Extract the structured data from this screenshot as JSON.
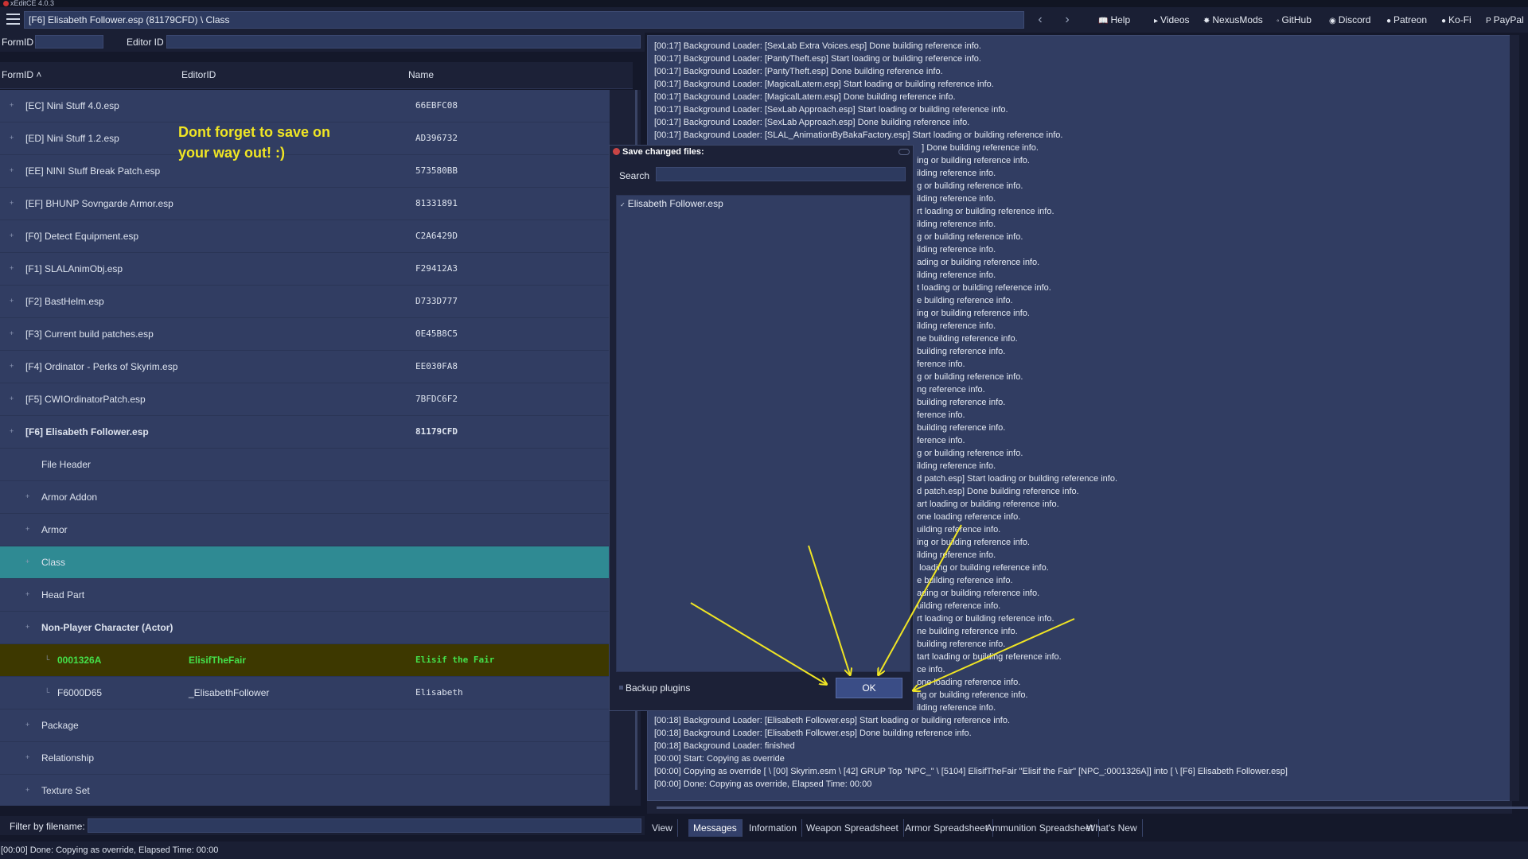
{
  "app": {
    "title": "xEditCE 4.0.3"
  },
  "header": {
    "path": "[F6] Elisabeth Follower.esp (81179CFD) \\ Class",
    "links": [
      {
        "label": "Help",
        "icon": "book-icon"
      },
      {
        "label": "Videos",
        "icon": "video-icon"
      },
      {
        "label": "NexusMods",
        "icon": "nexus-icon"
      },
      {
        "label": "GitHub",
        "icon": "github-icon"
      },
      {
        "label": "Discord",
        "icon": "discord-icon"
      },
      {
        "label": "Patreon",
        "icon": "patreon-icon"
      },
      {
        "label": "Ko-Fi",
        "icon": "kofi-icon"
      },
      {
        "label": "PayPal",
        "icon": "paypal-icon"
      }
    ]
  },
  "fields": {
    "formid_label": "FormID",
    "editorid_label": "Editor ID"
  },
  "columns": {
    "formid": "FormID",
    "editorid": "EditorID",
    "name": "Name"
  },
  "tree": [
    {
      "c1": "[EC] Nini Stuff 4.0.esp",
      "c2": "",
      "c3": "66EBFC08",
      "indent": 0
    },
    {
      "c1": "[ED] Nini Stuff 1.2.esp",
      "c2": "",
      "c3": "AD396732",
      "indent": 0
    },
    {
      "c1": "[EE] NINI Stuff Break Patch.esp",
      "c2": "",
      "c3": "573580BB",
      "indent": 0
    },
    {
      "c1": "[EF] BHUNP Sovngarde Armor.esp",
      "c2": "",
      "c3": "81331891",
      "indent": 0
    },
    {
      "c1": "[F0] Detect Equipment.esp",
      "c2": "",
      "c3": "C2A6429D",
      "indent": 0
    },
    {
      "c1": "[F1] SLALAnimObj.esp",
      "c2": "",
      "c3": "F29412A3",
      "indent": 0
    },
    {
      "c1": "[F2] BastHelm.esp",
      "c2": "",
      "c3": "D733D777",
      "indent": 0
    },
    {
      "c1": "[F3] Current build patches.esp",
      "c2": "",
      "c3": "0E45B8C5",
      "indent": 0
    },
    {
      "c1": "[F4] Ordinator - Perks of Skyrim.esp",
      "c2": "",
      "c3": "EE030FA8",
      "indent": 0
    },
    {
      "c1": "[F5] CWIOrdinatorPatch.esp",
      "c2": "",
      "c3": "7BFDC6F2",
      "indent": 0
    },
    {
      "c1": "[F6] Elisabeth Follower.esp",
      "c2": "",
      "c3": "81179CFD",
      "indent": 0,
      "bold": true
    },
    {
      "c1": "File Header",
      "c2": "",
      "c3": "",
      "indent": 1,
      "noexp": true
    },
    {
      "c1": "Armor Addon",
      "c2": "",
      "c3": "",
      "indent": 1
    },
    {
      "c1": "Armor",
      "c2": "",
      "c3": "",
      "indent": 1
    },
    {
      "c1": "Class",
      "c2": "",
      "c3": "",
      "indent": 1,
      "selected": true
    },
    {
      "c1": "Head Part",
      "c2": "",
      "c3": "",
      "indent": 1
    },
    {
      "c1": "Non-Player Character (Actor)",
      "c2": "",
      "c3": "",
      "indent": 1,
      "bold": true
    },
    {
      "c1": "0001326A",
      "c2": "ElisifTheFair",
      "c3": "Elisif the Fair",
      "indent": 2,
      "highlight": true,
      "noexp": true
    },
    {
      "c1": "F6000D65",
      "c2": "_ElisabethFollower",
      "c3": "Elisabeth",
      "indent": 2,
      "noexp": true
    },
    {
      "c1": "Package",
      "c2": "",
      "c3": "",
      "indent": 1
    },
    {
      "c1": "Relationship",
      "c2": "",
      "c3": "",
      "indent": 1
    },
    {
      "c1": "Texture Set",
      "c2": "",
      "c3": "",
      "indent": 1
    }
  ],
  "annotation": "Dont forget to save on\nyour way out! :)",
  "filter": {
    "label": "Filter by filename:"
  },
  "status": {
    "text": "[00:00] Done: Copying as override, Elapsed Time: 00:00"
  },
  "messages": [
    "[00:17] Background Loader: [SexLab Extra Voices.esp] Done building reference info.",
    "[00:17] Background Loader: [PantyTheft.esp] Start loading or building reference info.",
    "[00:17] Background Loader: [PantyTheft.esp] Done building reference info.",
    "[00:17] Background Loader: [MagicalLatern.esp] Start loading or building reference info.",
    "[00:17] Background Loader: [MagicalLatern.esp] Done building reference info.",
    "[00:17] Background Loader: [SexLab Approach.esp] Start loading or building reference info.",
    "[00:17] Background Loader: [SexLab Approach.esp] Done building reference info.",
    "[00:17] Background Loader: [SLAL_AnimationByBakaFactory.esp] Start loading or building reference info.",
    "                                                                                                              ] Done building reference info.",
    "                                                                                                            ing or building reference info.",
    "                                                                                                            ilding reference info.",
    "                                                                                                            g or building reference info.",
    "                                                                                                            ilding reference info.",
    "                                                                                                            rt loading or building reference info.",
    "                                                                                                            ilding reference info.",
    "                                                                                                            g or building reference info.",
    "                                                                                                            ilding reference info.",
    "                                                                                                            ading or building reference info.",
    "                                                                                                            ilding reference info.",
    "                                                                                                            t loading or building reference info.",
    "                                                                                                            e building reference info.",
    "                                                                                                            ing or building reference info.",
    "                                                                                                            ilding reference info.",
    "                                                                                                            ne building reference info.",
    "                                                                                                            building reference info.",
    "                                                                                                            ference info.",
    "                                                                                                            g or building reference info.",
    "                                                                                                            ng reference info.",
    "                                                                                                            building reference info.",
    "                                                                                                            ference info.",
    "                                                                                                            building reference info.",
    "                                                                                                            ference info.",
    "                                                                                                            g or building reference info.",
    "                                                                                                            ilding reference info.",
    "                                                                                                            d patch.esp] Start loading or building reference info.",
    "                                                                                                            d patch.esp] Done building reference info.",
    "                                                                                                            art loading or building reference info.",
    "                                                                                                            one loading reference info.",
    "                                                                                                            uilding reference info.",
    "                                                                                                            ing or building reference info.",
    "                                                                                                            ilding reference info.",
    "                                                                                                             loading or building reference info.",
    "                                                                                                            e building reference info.",
    "                                                                                                            ading or building reference info.",
    "                                                                                                            uilding reference info.",
    "                                                                                                            rt loading or building reference info.",
    "                                                                                                            ne building reference info.",
    "                                                                                                            building reference info.",
    "                                                                                                            tart loading or building reference info.",
    "                                                                                                            ce info.",
    "                                                                                                            one loading reference info.",
    "                                                                                                            ng or building reference info.",
    "                                                                                                            ilding reference info.",
    "[00:18] Background Loader: [Elisabeth Follower.esp] Start loading or building reference info.",
    "[00:18] Background Loader: [Elisabeth Follower.esp] Done building reference info.",
    "[00:18] Background Loader: finished",
    "[00:00] Start: Copying as override",
    "[00:00] Copying as override [ \\ [00] Skyrim.esm \\ [42] GRUP Top \"NPC_\" \\ [5104] ElisifTheFair \"Elisif the Fair\" [NPC_:0001326A]] into [ \\ [F6] Elisabeth Follower.esp]",
    "[00:00] Done: Copying as override, Elapsed Time: 00:00"
  ],
  "tabs": [
    "View",
    "Messages",
    "Information",
    "Weapon Spreadsheet",
    "Armor Spreadsheet",
    "Ammunition Spreadsheet",
    "What's New"
  ],
  "active_tab": "Messages",
  "dialog": {
    "title": "Save changed files:",
    "search_label": "Search",
    "item": "Elisabeth Follower.esp",
    "backup_label": "Backup plugins",
    "ok_label": "OK"
  }
}
